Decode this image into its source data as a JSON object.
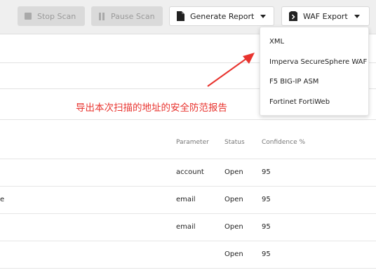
{
  "toolbar": {
    "stop_scan": "Stop Scan",
    "pause_scan": "Pause Scan",
    "generate_report": "Generate Report",
    "waf_export": "WAF Export"
  },
  "waf_menu": {
    "items": [
      "XML",
      "Imperva SecureSphere WAF",
      "F5 BIG-IP ASM",
      "Fortinet FortiWeb"
    ]
  },
  "annotation": {
    "text": "导出本次扫描的地址的安全防范报告",
    "color": "#e8332e"
  },
  "table": {
    "headers": [
      "Parameter",
      "Status",
      "Confidence %"
    ],
    "rows": [
      {
        "left_fragment": "",
        "parameter": "account",
        "status": "Open",
        "confidence": "95"
      },
      {
        "left_fragment": "e",
        "parameter": "email",
        "status": "Open",
        "confidence": "95"
      },
      {
        "left_fragment": "",
        "parameter": "email",
        "status": "Open",
        "confidence": "95"
      },
      {
        "left_fragment": "",
        "parameter": "",
        "status": "Open",
        "confidence": "95"
      }
    ]
  }
}
